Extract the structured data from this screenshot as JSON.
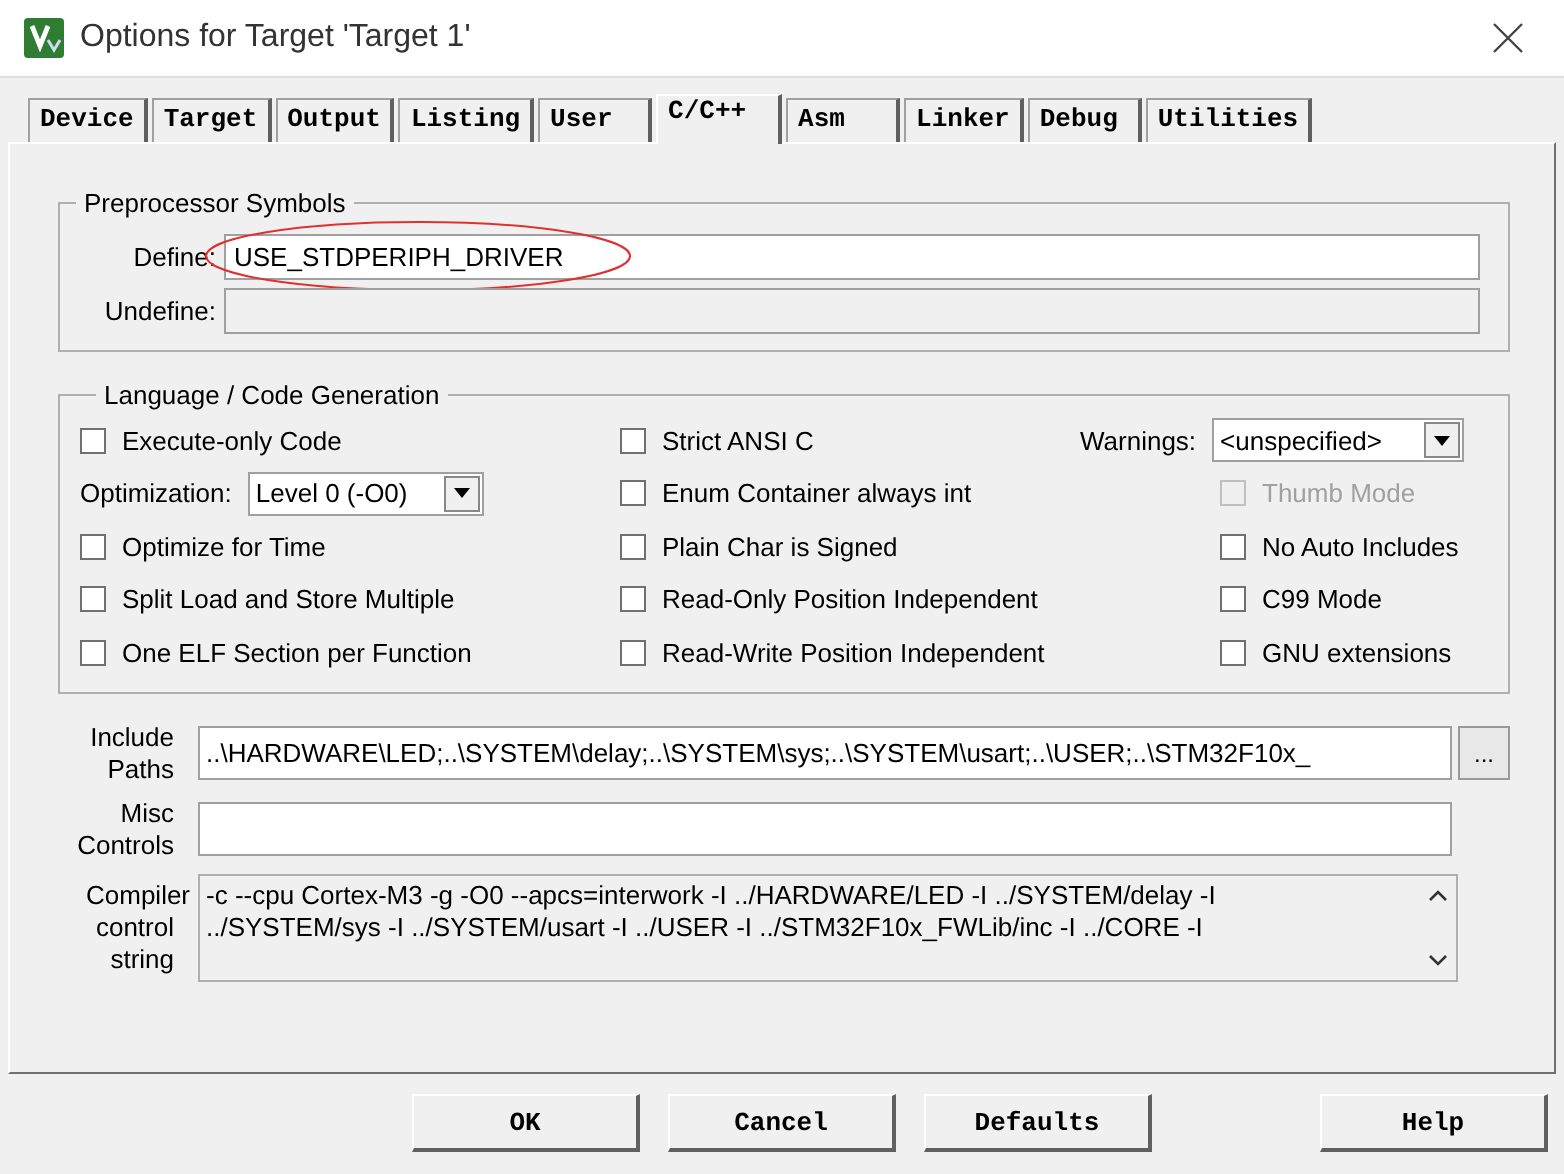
{
  "window": {
    "title": "Options for Target 'Target 1'"
  },
  "tabs": [
    {
      "label": "Device",
      "selected": false
    },
    {
      "label": "Target",
      "selected": false
    },
    {
      "label": "Output",
      "selected": false
    },
    {
      "label": "Listing",
      "selected": false
    },
    {
      "label": "User",
      "selected": false
    },
    {
      "label": "C/C++",
      "selected": true
    },
    {
      "label": "Asm",
      "selected": false
    },
    {
      "label": "Linker",
      "selected": false
    },
    {
      "label": "Debug",
      "selected": false
    },
    {
      "label": "Utilities",
      "selected": false
    }
  ],
  "preprocessor": {
    "title": "Preprocessor Symbols",
    "fields": [
      {
        "label": "Define:",
        "value": "USE_STDPERIPH_DRIVER",
        "disabled": false,
        "circled": true
      },
      {
        "label": "Undefine:",
        "disabled": true,
        "circled": false
      }
    ]
  },
  "language": {
    "title": "Language / Code Generation",
    "columns": [
      [
        {
          "kind": "checkbox",
          "label": "Execute-only Code",
          "checked": false,
          "disabled": false
        },
        {
          "kind": "dropdown",
          "label": "Optimization:",
          "value": "Level 0 (-O0)"
        },
        {
          "kind": "checkbox",
          "label": "Optimize for Time",
          "checked": false,
          "disabled": false
        },
        {
          "kind": "checkbox",
          "label": "Split Load and Store Multiple",
          "checked": false,
          "disabled": false
        },
        {
          "kind": "checkbox",
          "label": "One ELF Section per Function",
          "checked": false,
          "disabled": false
        }
      ],
      [
        {
          "kind": "checkbox",
          "label": "Strict ANSI C",
          "checked": false,
          "disabled": false
        },
        {
          "kind": "checkbox",
          "label": "Enum Container always int",
          "checked": false,
          "disabled": false
        },
        {
          "kind": "checkbox",
          "label": "Plain Char is Signed",
          "checked": false,
          "disabled": false
        },
        {
          "kind": "checkbox",
          "label": "Read-Only Position Independent",
          "checked": false,
          "disabled": false
        },
        {
          "kind": "checkbox",
          "label": "Read-Write Position Independent",
          "checked": false,
          "disabled": false
        }
      ],
      [
        {
          "kind": "dropdown",
          "label": "Warnings:",
          "value": "<unspecified>"
        },
        {
          "kind": "checkbox",
          "label": "Thumb Mode",
          "checked": false,
          "disabled": true
        },
        {
          "kind": "checkbox",
          "label": "No Auto Includes",
          "checked": false,
          "disabled": false
        },
        {
          "kind": "checkbox",
          "label": "C99 Mode",
          "checked": false,
          "disabled": false
        },
        {
          "kind": "checkbox",
          "label": "GNU extensions",
          "checked": false,
          "disabled": false
        }
      ]
    ]
  },
  "paths": [
    {
      "kind": "field",
      "label": "Include Paths",
      "value": "..\\HARDWARE\\LED;..\\SYSTEM\\delay;..\\SYSTEM\\sys;..\\SYSTEM\\usart;..\\USER;..\\STM32F10x_",
      "browse": "..."
    },
    {
      "kind": "field",
      "label": "Misc Controls"
    },
    {
      "kind": "text",
      "label": "Compiler control string",
      "lines": [
        "-c --cpu Cortex-M3 -g -O0 --apcs=interwork -I ../HARDWARE/LED -I ../SYSTEM/delay -I",
        "../SYSTEM/sys -I ../SYSTEM/usart -I ../USER -I ../STM32F10x_FWLib/inc -I ../CORE -I"
      ]
    }
  ],
  "buttons": [
    "OK",
    "Cancel",
    "Defaults",
    "Help"
  ]
}
